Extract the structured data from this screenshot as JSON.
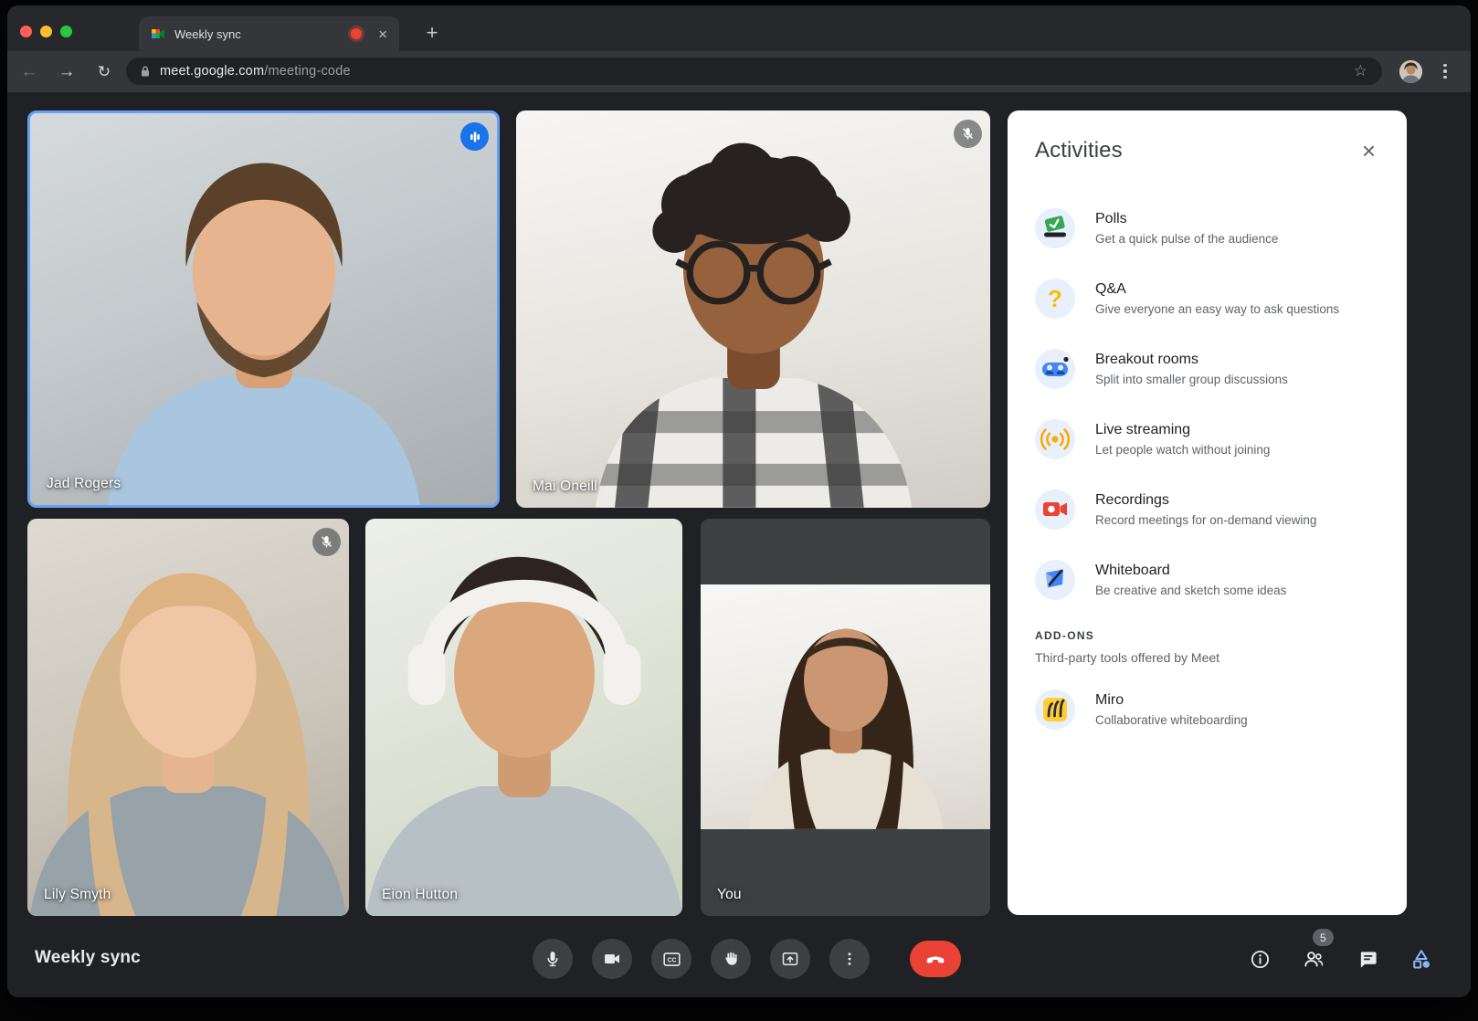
{
  "colors": {
    "accent_blue": "#8ab4f8",
    "speaking_border": "#68a0f6",
    "speaking_chip": "#1a73e8",
    "end_call_red": "#ea4335",
    "panel_icon_bg": "#e8f0fe",
    "surface_dark": "#202124",
    "control_gray": "#3c4043"
  },
  "browser": {
    "tab_title": "Weekly sync",
    "tab_recording": true,
    "tab_close_glyph": "×",
    "new_tab_label": "+",
    "back_glyph": "←",
    "forward_glyph": "→",
    "reload_glyph": "↻",
    "star_glyph": "☆",
    "url": {
      "host": "meet.google.com",
      "path": "/meeting-code"
    }
  },
  "meeting": {
    "title": "Weekly sync",
    "people_badge": "5",
    "participants": [
      {
        "name": "Jad Rogers",
        "status": "speaking"
      },
      {
        "name": "Mai Oneill",
        "status": "muted"
      },
      {
        "name": "Lily Smyth",
        "status": "muted"
      },
      {
        "name": "Eion Hutton",
        "status": "none"
      },
      {
        "name": "You",
        "status": "none"
      }
    ],
    "controls": [
      "microphone",
      "camera",
      "captions",
      "raise-hand",
      "present-screen",
      "more-options",
      "end-call"
    ],
    "status_buttons": [
      "meeting-details",
      "people",
      "chat",
      "activities"
    ]
  },
  "activities": {
    "title": "Activities",
    "items": [
      {
        "label": "Polls",
        "description": "Get a quick pulse of the audience",
        "icon": "ballot-box"
      },
      {
        "label": "Q&A",
        "description": "Give everyone an easy way to ask questions",
        "icon": "question-mark"
      },
      {
        "label": "Breakout rooms",
        "description": "Split into smaller group discussions",
        "icon": "breakout-people"
      },
      {
        "label": "Live streaming",
        "description": "Let people watch without joining",
        "icon": "broadcast"
      },
      {
        "label": "Recordings",
        "description": "Record meetings for on-demand viewing",
        "icon": "video-camera"
      },
      {
        "label": "Whiteboard",
        "description": "Be creative and sketch some ideas",
        "icon": "whiteboard-pen"
      }
    ],
    "addons_header": "ADD-ONS",
    "addons_subheader": "Third-party tools offered by Meet",
    "addons": [
      {
        "label": "Miro",
        "description": "Collaborative whiteboarding",
        "icon": "miro-logo"
      }
    ]
  }
}
